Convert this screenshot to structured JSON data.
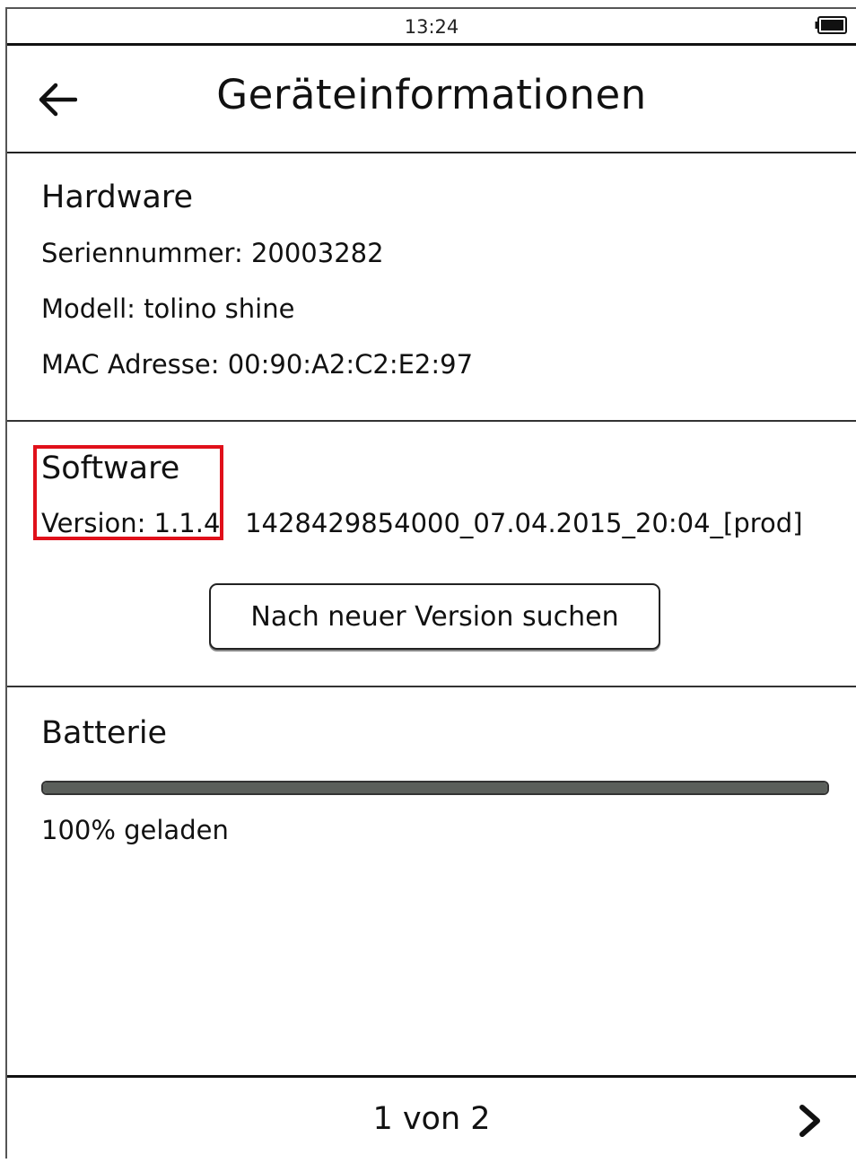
{
  "status_bar": {
    "time": "13:24",
    "battery_icon": "battery-full-icon"
  },
  "header": {
    "back_icon": "arrow-left-icon",
    "title": "Geräteinformationen"
  },
  "hardware": {
    "heading": "Hardware",
    "serial": "Seriennummer: 20003282",
    "model": "Modell: tolino shine",
    "mac": "MAC Adresse: 00:90:A2:C2:E2:97"
  },
  "software": {
    "heading": "Software",
    "version": "Version: 1.1.4   1428429854000_07.04.2015_20:04_[prod]",
    "update_button_label": "Nach neuer Version suchen",
    "highlight_color": "#e0101a"
  },
  "battery": {
    "heading": "Batterie",
    "level_percent": 100,
    "status": "100% geladen",
    "bar_color": "#5b5f5b"
  },
  "footer": {
    "page_indicator": "1 von 2",
    "next_icon": "chevron-right-icon"
  }
}
